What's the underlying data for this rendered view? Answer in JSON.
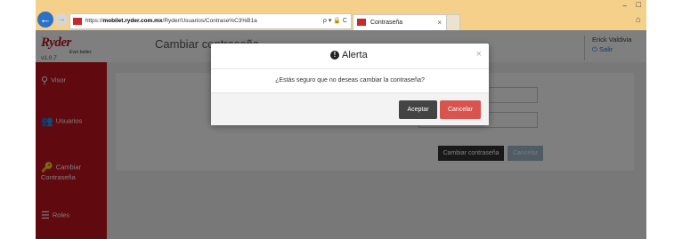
{
  "browser": {
    "url_prefix": "https://",
    "url_domain": "mobilet.ryder.com.mx",
    "url_path": "/Ryder/Usuarios/Contrase%C3%B1a",
    "addr_tools": "ρ ▾ 🔒 C",
    "tab_title": "Contraseña",
    "tab_close": "×",
    "back_glyph": "←",
    "forward_glyph": "→",
    "minimize_glyph": "–",
    "maximize_glyph": "□",
    "home_glyph": "⌂"
  },
  "app": {
    "logo": "Ryder",
    "logo_tagline": "Ever better.",
    "version": "v1.0.7",
    "page_title": "Cambiar contraseña",
    "user_name": "Erick Valdivia",
    "logout": "Salir",
    "logout_icon": "⏻"
  },
  "sidebar": {
    "items": [
      {
        "label": "Visor",
        "icon": "map-marker-icon",
        "glyph": "⚲"
      },
      {
        "label": "Usuarios",
        "icon": "users-icon",
        "glyph": "👥"
      },
      {
        "label": "Cambiar Contraseña",
        "icon": "key-icon",
        "glyph": "🔑"
      },
      {
        "label": "Roles",
        "icon": "list-icon",
        "glyph": "☰"
      }
    ]
  },
  "form": {
    "change_button": "Cambiar contraseña",
    "cancel_button": "Cancelar"
  },
  "modal": {
    "title": "Alerta",
    "icon_glyph": "!",
    "close_glyph": "×",
    "message": "¿Estás seguro que no deseas cambiar la contraseña?",
    "accept": "Aceptar",
    "cancel": "Cancelar"
  },
  "colors": {
    "brand_red": "#c1121f",
    "danger": "#d9534f",
    "dark_button": "#444444",
    "browser_frame": "#f4d08a"
  }
}
